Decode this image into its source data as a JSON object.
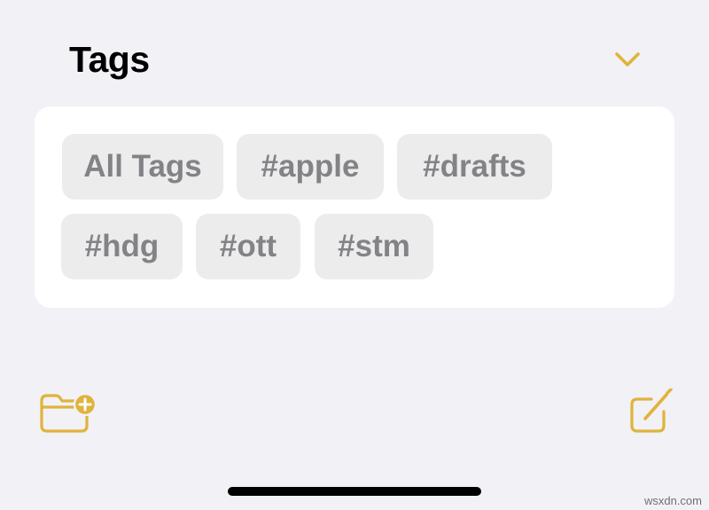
{
  "header": {
    "title": "Tags",
    "chevron_icon": "chevron-down-icon"
  },
  "tags": {
    "row1": [
      "All Tags",
      "#apple",
      "#drafts"
    ],
    "row2": [
      "#hdg",
      "#ott",
      "#stm"
    ]
  },
  "toolbar": {
    "new_folder_icon": "folder-plus-icon",
    "compose_icon": "square-and-pencil-icon"
  },
  "watermark": "wsxdn.com",
  "colors": {
    "accent": "#e0b33c",
    "background": "#f2f1f6",
    "card": "#ffffff",
    "chip": "#ececed",
    "chip_text": "#838387"
  }
}
